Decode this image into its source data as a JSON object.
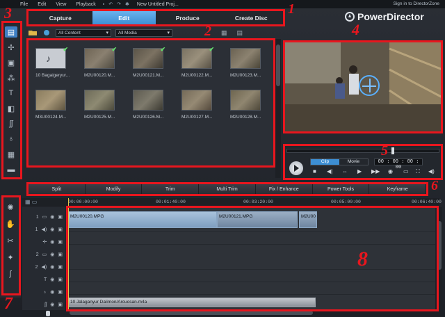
{
  "menu": {
    "items": [
      "File",
      "Edit",
      "View",
      "Playback"
    ],
    "project_title": "New Untitled Proj...",
    "signin": "Sign in to DirectorZone"
  },
  "tabs": [
    {
      "label": "Capture",
      "active": false
    },
    {
      "label": "Edit",
      "active": true
    },
    {
      "label": "Produce",
      "active": false
    },
    {
      "label": "Create Disc",
      "active": false
    }
  ],
  "brand": "PowerDirector",
  "library": {
    "filter1": "All Content",
    "filter2": "All Media",
    "items": [
      {
        "label": "10 Bagaigeryur...",
        "type": "audio",
        "checked": true
      },
      {
        "label": "M2U00120.M...",
        "type": "video",
        "checked": true
      },
      {
        "label": "M2U00121.M...",
        "type": "video",
        "checked": true
      },
      {
        "label": "M2U00122.M...",
        "type": "video",
        "checked": true
      },
      {
        "label": "M2U00123.M...",
        "type": "video",
        "checked": false
      },
      {
        "label": "M3U00124.M...",
        "type": "video",
        "checked": false
      },
      {
        "label": "M2U00125.M...",
        "type": "video",
        "checked": false
      },
      {
        "label": "M2U00126.M...",
        "type": "video",
        "checked": false
      },
      {
        "label": "M2U00127.M...",
        "type": "video",
        "checked": false
      },
      {
        "label": "M2U00128.M...",
        "type": "video",
        "checked": false
      }
    ]
  },
  "player": {
    "mode_clip": "Clip",
    "mode_movie": "Movie",
    "timecode": "00 : 00 : 00 : 00"
  },
  "functions": [
    "Split",
    "Modify",
    "Trim",
    "Multi Trim",
    "Fix / Enhance",
    "Power Tools",
    "Keyframe"
  ],
  "timeline": {
    "ruler": [
      "00:00:00:00",
      "00:01:40:00",
      "00:03:20:00",
      "00:05:00:00",
      "00:06:40:00"
    ],
    "tracks": [
      {
        "num": "1",
        "kind": "video"
      },
      {
        "num": "1",
        "kind": "audio"
      },
      {
        "num": "",
        "kind": "fx"
      },
      {
        "num": "2",
        "kind": "video"
      },
      {
        "num": "2",
        "kind": "audio"
      },
      {
        "num": "",
        "kind": "title"
      },
      {
        "num": "",
        "kind": "voice"
      },
      {
        "num": "",
        "kind": "music"
      }
    ],
    "clips": {
      "v1": "M2U00120.MPG",
      "v2": "M2U00121.MPG",
      "v3": "M2U00",
      "music": "10 Jalaganyur Dalimon/Arcuosan.m4a"
    }
  },
  "annotations": [
    "1",
    "2",
    "3",
    "4",
    "5",
    "6",
    "7",
    "8"
  ],
  "colors": {
    "accent": "#3d8fd4",
    "annotation": "#e8161e"
  }
}
